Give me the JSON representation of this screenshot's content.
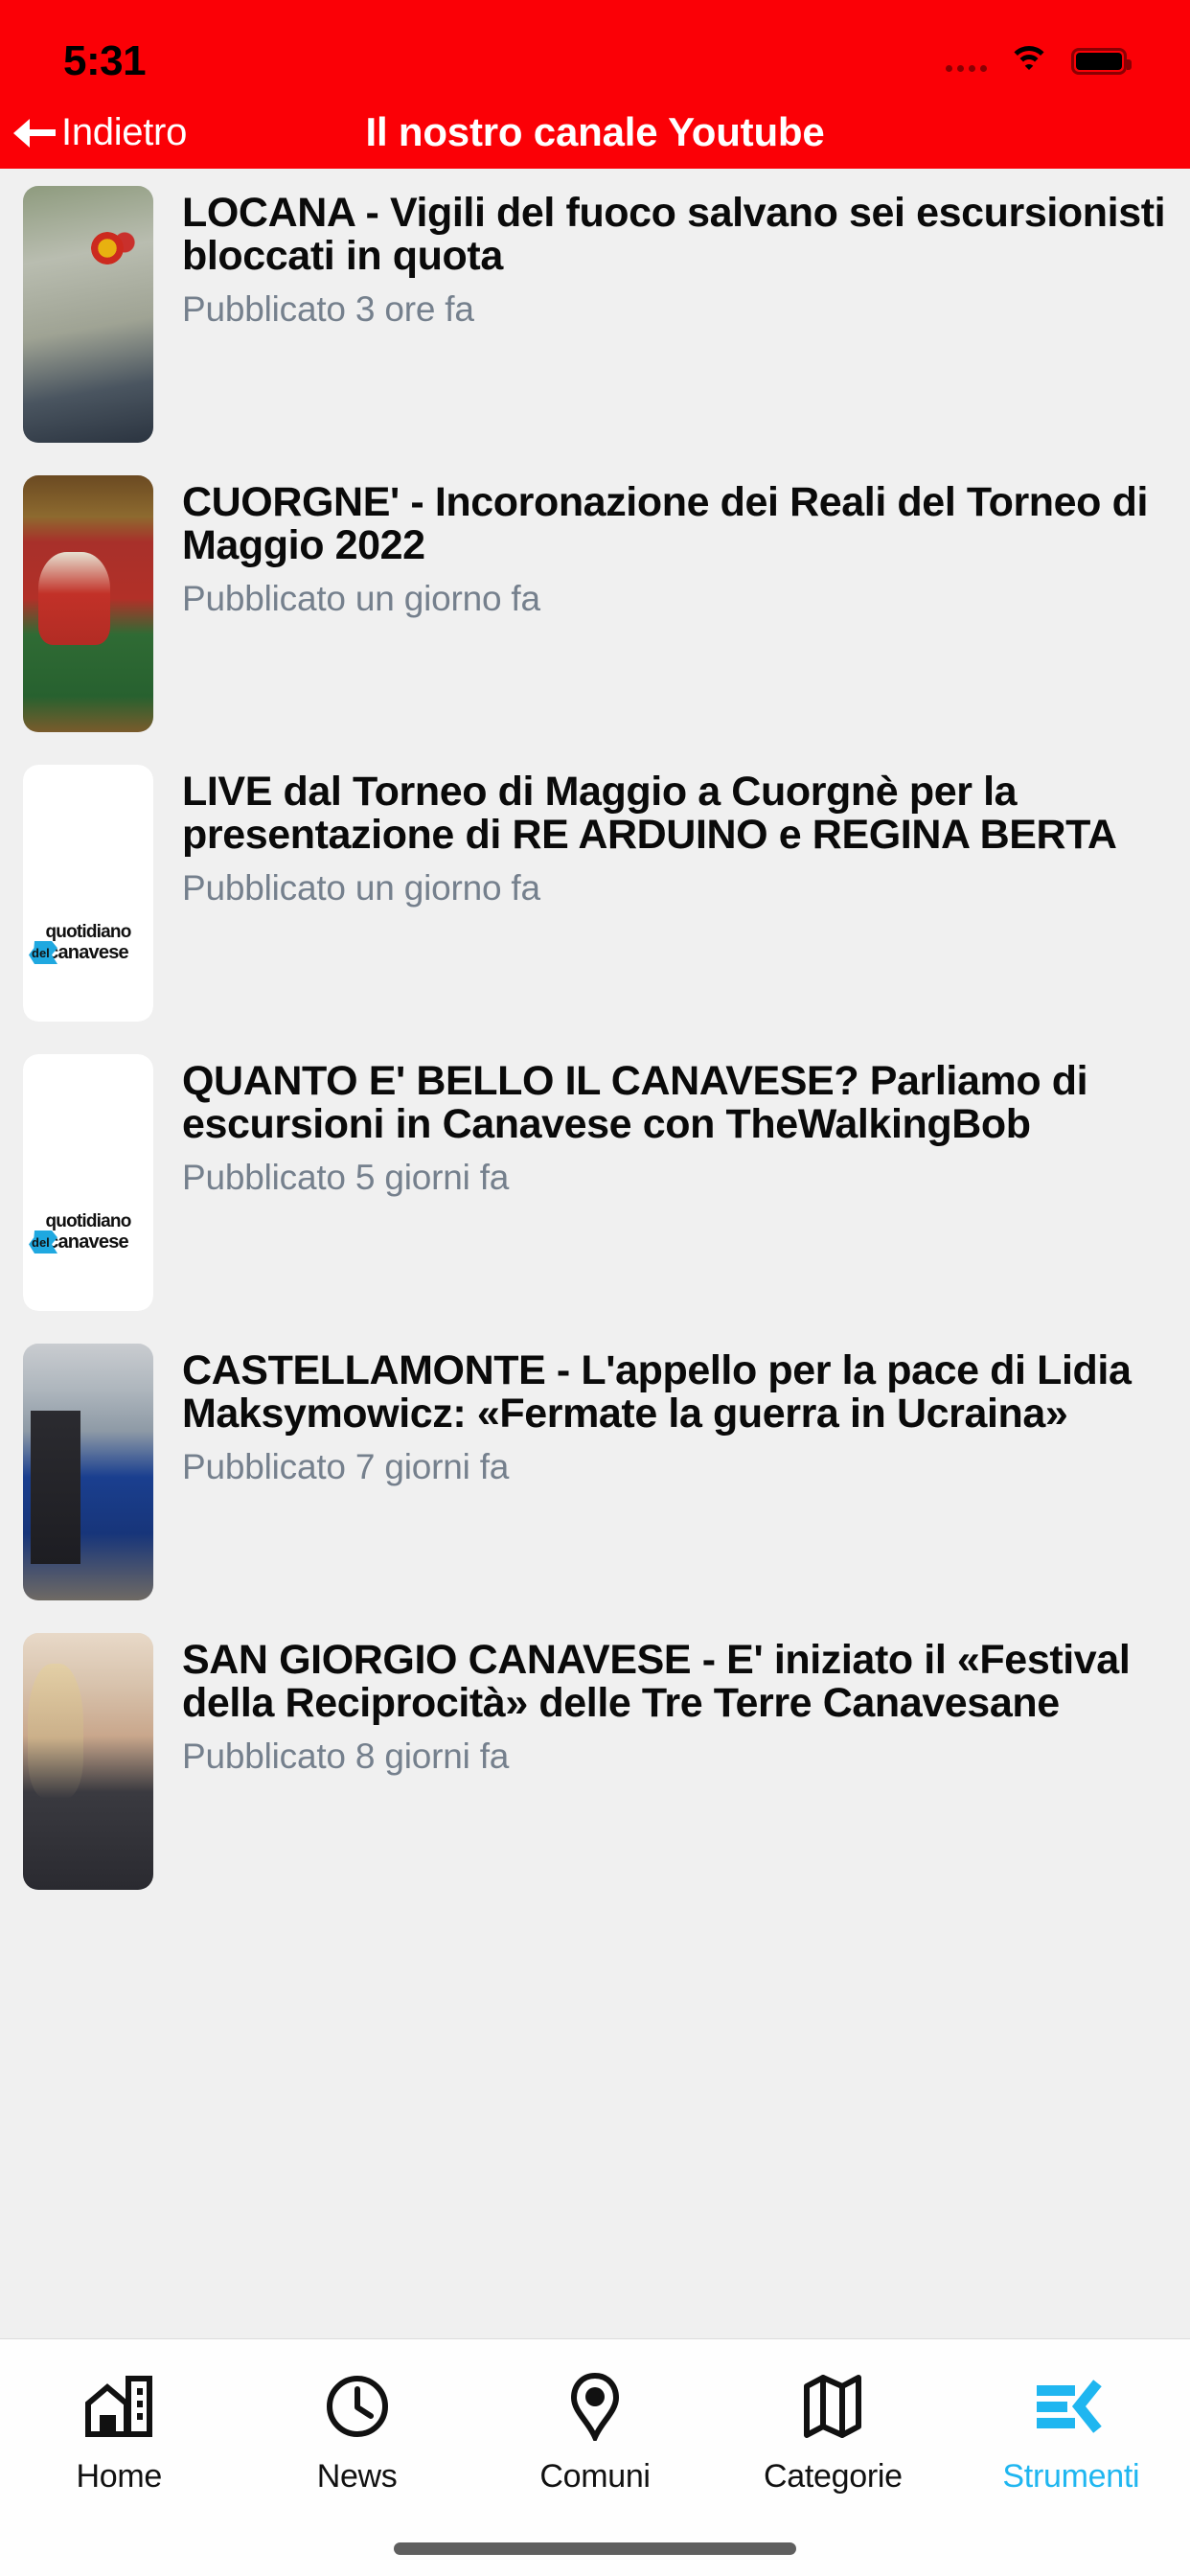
{
  "status_bar": {
    "time": "5:31",
    "icons": [
      "signal-dots-icon",
      "wifi-icon",
      "battery-icon"
    ],
    "background_color": "#fb0006"
  },
  "nav_bar": {
    "back_label": "Indietro",
    "back_icon": "arrow-left-icon",
    "title": "Il nostro canale Youtube",
    "background_color": "#fb0006",
    "text_color": "#ffffff"
  },
  "list": {
    "items": [
      {
        "title": "LOCANA - Vigili del fuoco salvano sei escursionisti bloccati in quota",
        "meta": "Pubblicato 3 ore fa",
        "thumbnail": "rescue-mountain-photo"
      },
      {
        "title": "CUORGNE' - Incoronazione dei Reali del Torneo di Maggio 2022",
        "meta": "Pubblicato un giorno fa",
        "thumbnail": "medieval-ceremony-photo"
      },
      {
        "title": "LIVE dal Torneo di Maggio a Cuorgnè per la presentazione di RE ARDUINO e REGINA BERTA",
        "meta": "Pubblicato un giorno fa",
        "thumbnail": "quotidiano-canavese-logo"
      },
      {
        "title": "QUANTO E' BELLO IL CANAVESE? Parliamo di escursioni in Canavese con TheWalkingBob",
        "meta": "Pubblicato 5 giorni fa",
        "thumbnail": "quotidiano-canavese-logo"
      },
      {
        "title": "CASTELLAMONTE - L'appello per la pace di Lidia Maksymowicz: «Fermate la guerra in Ucraina»",
        "meta": "Pubblicato 7 giorni fa",
        "thumbnail": "two-women-outdoor-photo"
      },
      {
        "title": "SAN GIORGIO CANAVESE - E' iniziato il «Festival della Reciprocità» delle Tre Terre Canavesane",
        "meta": "Pubblicato 8 giorni fa",
        "thumbnail": "interview-photo"
      }
    ],
    "logo_text": {
      "line1": "quotidiano",
      "line2": "canavese",
      "badge": "del"
    }
  },
  "tab_bar": {
    "active_color": "#1fb6f0",
    "inactive_color": "#111111",
    "tabs": [
      {
        "label": "Home",
        "icon": "building-home-icon",
        "active": false
      },
      {
        "label": "News",
        "icon": "clock-icon",
        "active": false
      },
      {
        "label": "Comuni",
        "icon": "map-pin-icon",
        "active": false
      },
      {
        "label": "Categorie",
        "icon": "folded-map-icon",
        "active": false
      },
      {
        "label": "Strumenti",
        "icon": "tools-menu-chevron-icon",
        "active": true
      }
    ]
  }
}
